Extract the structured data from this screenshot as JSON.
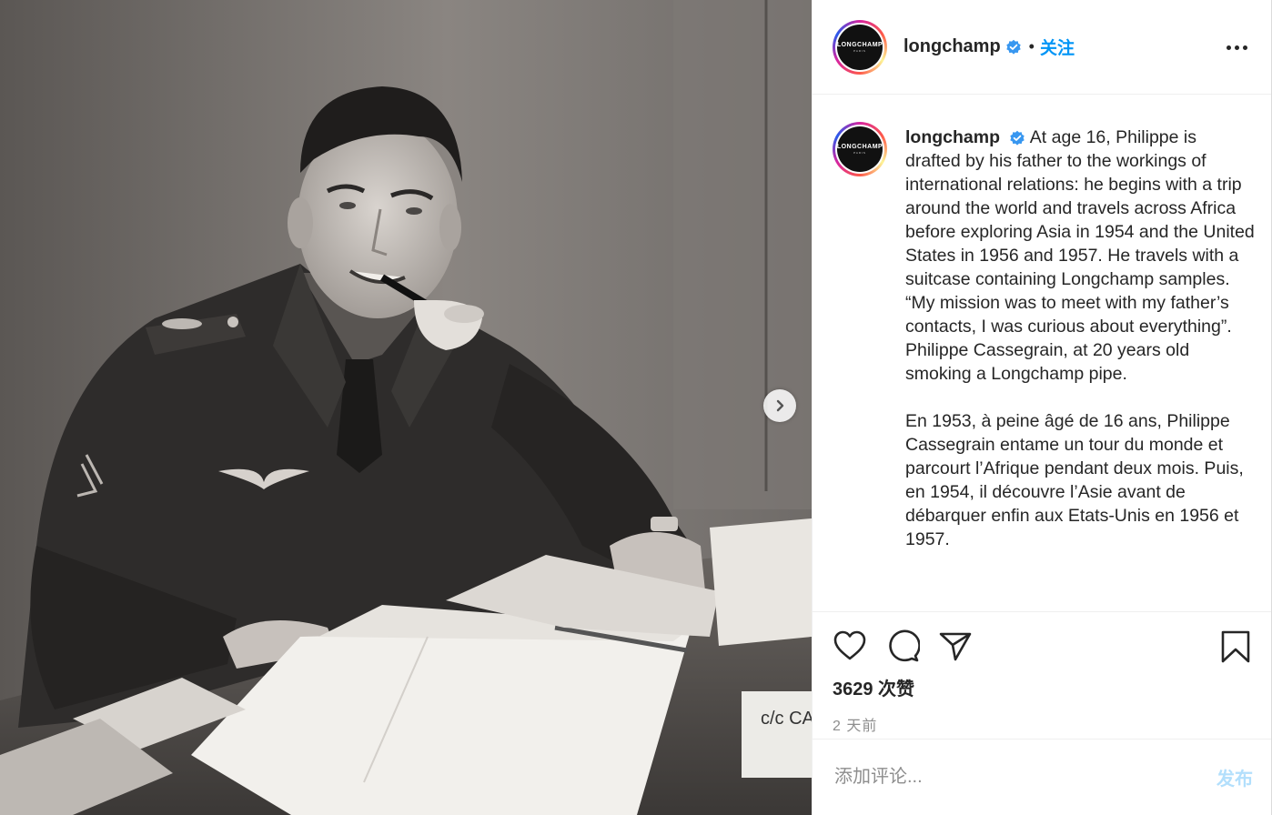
{
  "post": {
    "username": "longchamp",
    "follow_label": "关注",
    "separator": "•",
    "avatar_logo": "LONGCHAMP",
    "avatar_sub": "PARIS"
  },
  "caption": {
    "username": "longchamp",
    "paragraph_en": "At age 16, Philippe is drafted by his father to the workings of international relations: he begins with a trip around the world and travels across Africa before exploring Asia in 1954 and the United States in 1956 and 1957. He travels with a suitcase containing Longchamp samples. “My mission was to meet with my father’s contacts, I was curious about everything”. Philippe Cassegrain, at 20 years old smoking a Longchamp pipe.",
    "paragraph_fr": "En 1953, à peine âgé de 16 ans, Philippe Cassegrain entame un tour du monde et parcourt l’Afrique pendant deux mois. Puis, en 1954, il découvre l’Asie avant de débarquer enfin aux Etats-Unis en 1956 et 1957."
  },
  "engagement": {
    "likes": "3629 次赞",
    "time": "2 天前"
  },
  "comment": {
    "placeholder": "添加评论...",
    "post_label": "发布"
  },
  "photo": {
    "doc_label": "c/c CA"
  },
  "icons": {
    "like": "heart-icon",
    "comment": "comment-bubble-icon",
    "share": "paper-plane-icon",
    "save": "bookmark-icon",
    "more": "more-options-icon",
    "next": "chevron-right-icon",
    "verified": "verified-badge-icon"
  },
  "colors": {
    "accent": "#0095f6",
    "verified": "#3897f0",
    "post_disabled": "#b2dffc",
    "muted": "#8e8e8e"
  }
}
